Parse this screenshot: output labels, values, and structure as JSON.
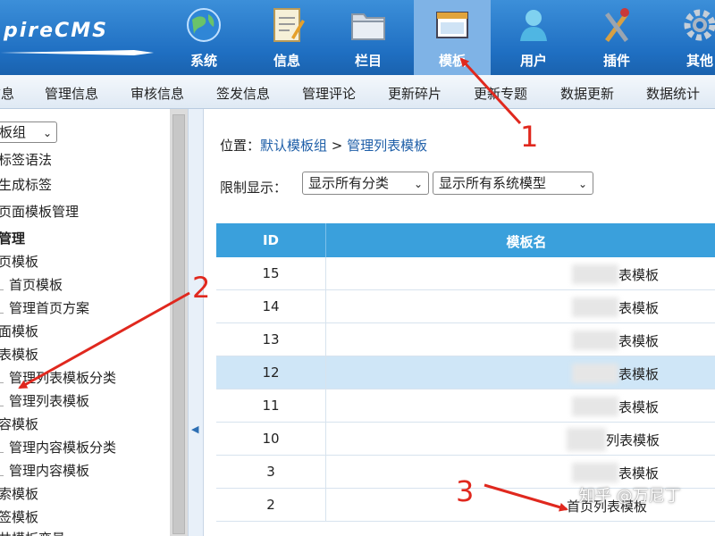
{
  "header": {
    "logo_text": "pireCMS",
    "nav": [
      {
        "label": "系统",
        "icon": "globe-icon"
      },
      {
        "label": "信息",
        "icon": "notepad-icon"
      },
      {
        "label": "栏目",
        "icon": "folder-icon"
      },
      {
        "label": "模板",
        "icon": "window-icon",
        "active": true
      },
      {
        "label": "用户",
        "icon": "user-icon"
      },
      {
        "label": "插件",
        "icon": "tools-icon"
      },
      {
        "label": "其他",
        "icon": "gear-icon"
      }
    ]
  },
  "submenu": [
    "信息",
    "管理信息",
    "审核信息",
    "签发信息",
    "管理评论",
    "更新碎片",
    "更新专题",
    "数据更新",
    "数据统计"
  ],
  "sidebar": {
    "group_select": "板组",
    "items": [
      {
        "label": "标签语法"
      },
      {
        "label": "生成标签"
      },
      {
        "label": "页面模板管理"
      },
      {
        "label": "管理",
        "bold": true
      },
      {
        "label": "页模板"
      },
      {
        "label": "首页模板",
        "sub": true
      },
      {
        "label": "管理首页方案",
        "sub": true
      },
      {
        "label": "面模板"
      },
      {
        "label": "表模板"
      },
      {
        "label": "管理列表模板分类",
        "sub": true
      },
      {
        "label": "管理列表模板",
        "sub": true
      },
      {
        "label": "容模板"
      },
      {
        "label": "管理内容模板分类",
        "sub": true
      },
      {
        "label": "管理内容模板",
        "sub": true
      },
      {
        "label": "索模板"
      },
      {
        "label": "签模板"
      },
      {
        "label": "共模板变量"
      }
    ]
  },
  "main": {
    "breadcrumb_prefix": "位置：",
    "breadcrumb_link1": "默认模板组",
    "breadcrumb_sep": " > ",
    "breadcrumb_link2": "管理列表模板",
    "filter_label": "限制显示：",
    "select_category": "显示所有分类",
    "select_model": "显示所有系统模型",
    "table": {
      "columns": [
        "ID",
        "模板名"
      ],
      "rows": [
        {
          "id": "15",
          "name": "表模板"
        },
        {
          "id": "14",
          "name": "表模板"
        },
        {
          "id": "13",
          "name": "表模板"
        },
        {
          "id": "12",
          "name": "表模板",
          "highlight": true
        },
        {
          "id": "11",
          "name": "表模板"
        },
        {
          "id": "10",
          "name": "列表模板"
        },
        {
          "id": "3",
          "name": "表模板"
        },
        {
          "id": "2",
          "name": "首页列表模板"
        }
      ]
    }
  },
  "annotations": {
    "n1": "1",
    "n2": "2",
    "n3": "3",
    "color": "#e0281e"
  },
  "watermark": "知乎 @万尼丁"
}
